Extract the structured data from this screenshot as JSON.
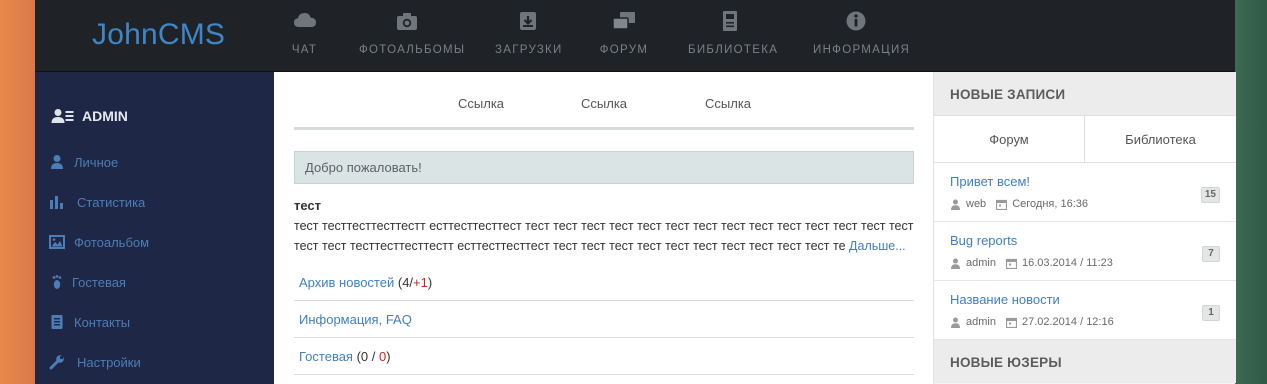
{
  "brand": {
    "name": "JohnCMS"
  },
  "topnav": [
    {
      "label": "ЧАТ",
      "icon": "cloud-icon"
    },
    {
      "label": "ФОТОАЛЬБОМЫ",
      "icon": "camera-icon"
    },
    {
      "label": "ЗАГРУЗКИ",
      "icon": "download-box-icon"
    },
    {
      "label": "ФОРУМ",
      "icon": "chat-bubbles-icon"
    },
    {
      "label": "БИБЛИОТЕКА",
      "icon": "book-icon"
    },
    {
      "label": "ИНФОРМАЦИЯ",
      "icon": "info-circle-icon"
    }
  ],
  "sidebar": {
    "user": "ADMIN",
    "items": [
      {
        "label": "Личное",
        "icon": "user-icon"
      },
      {
        "label": "Статистика",
        "icon": "bar-chart-icon"
      },
      {
        "label": "Фотоальбом",
        "icon": "picture-icon"
      },
      {
        "label": "Гостевая",
        "icon": "footprint-icon"
      },
      {
        "label": "Контакты",
        "icon": "contacts-book-icon"
      },
      {
        "label": "Настройки",
        "icon": "wrench-icon"
      }
    ]
  },
  "main": {
    "links": [
      "Ссылка",
      "Ссылка",
      "Ссылка"
    ],
    "welcome": "Добро пожаловать!",
    "news": {
      "title": "тест",
      "line1": "тест тесттесттесттестт есттесттесттест тест тест тест тест тест тест тест тест тест тест тест тест тест тест",
      "line2": "тест тест тесттесттесттестт есттесттесттест тест тест тест тест тест тест тест тест тест тест те",
      "more": "Дальше..."
    },
    "list": [
      {
        "label": "Архив новостей",
        "a": "4",
        "sep": "/",
        "b": "+1"
      },
      {
        "label": "Информация, FAQ"
      },
      {
        "label": "Гостевая",
        "a": "0",
        "sep": "/",
        "b": "0"
      }
    ]
  },
  "right": {
    "new_posts_title": "НОВЫЕ ЗАПИСИ",
    "tabs": [
      "Форум",
      "Библиотека"
    ],
    "posts": [
      {
        "title": "Привет всем!",
        "author": "web",
        "date": "Сегодня, 16:36",
        "count": "15"
      },
      {
        "title": "Bug reports",
        "author": "admin",
        "date": "16.03.2014 / 11:23",
        "count": "7"
      },
      {
        "title": "Название новости",
        "author": "admin",
        "date": "27.02.2014 / 12:16",
        "count": "1"
      }
    ],
    "new_users_title": "НОВЫЕ ЮЗЕРЫ"
  }
}
